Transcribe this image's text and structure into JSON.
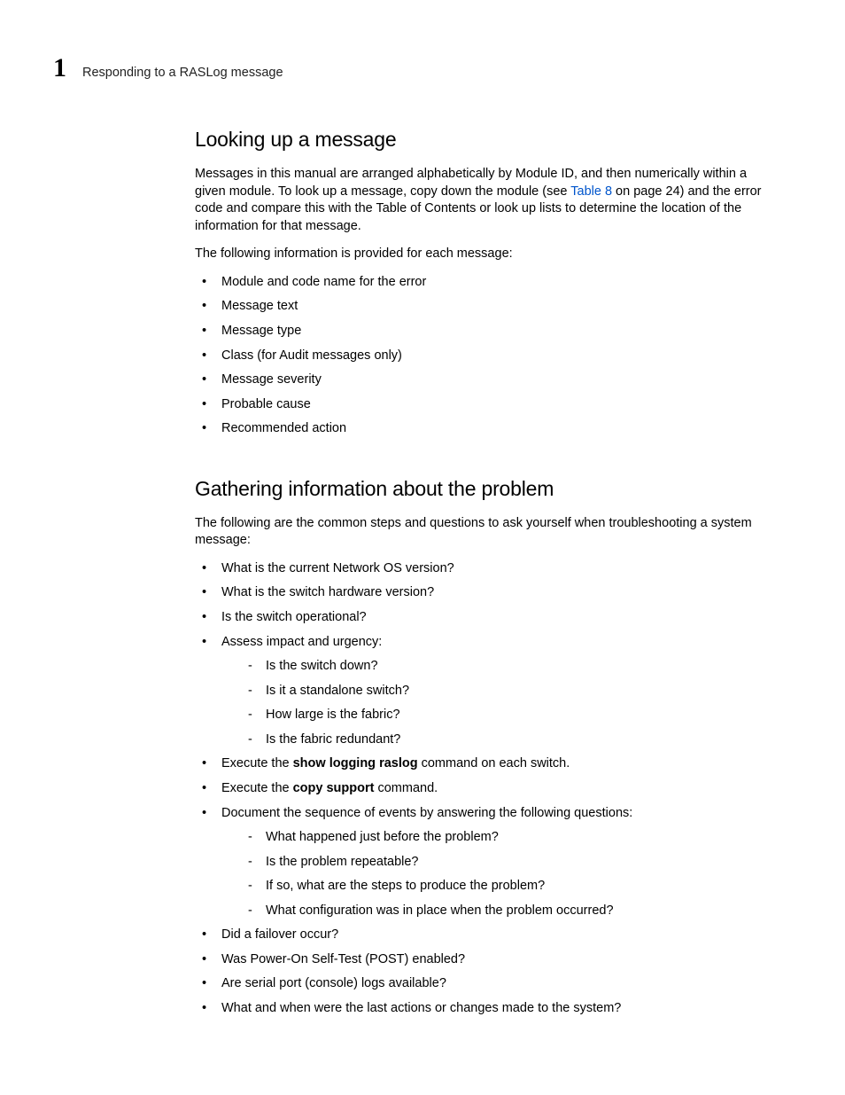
{
  "header": {
    "chapter_num": "1",
    "running_title": "Responding to a RASLog message"
  },
  "section1": {
    "heading": "Looking up a message",
    "para1_a": "Messages in this manual are arranged alphabetically by Module ID, and then numerically within a given module. To look up a message, copy down the module (see ",
    "para1_link": "Table 8",
    "para1_b": " on page 24) and the error code and compare this with the Table of Contents or look up lists to determine the location of the information for that message.",
    "para2": "The following information is provided for each message:",
    "bullets": [
      "Module and code name for the error",
      "Message text",
      "Message type",
      "Class (for Audit messages only)",
      "Message severity",
      "Probable cause",
      "Recommended action"
    ]
  },
  "section2": {
    "heading": "Gathering information about the problem",
    "para1": "The following are the common steps and questions to ask yourself when troubleshooting a system message:",
    "b1": "What is the current Network OS version?",
    "b2": "What is the switch hardware version?",
    "b3": "Is the switch operational?",
    "b4": "Assess impact and urgency:",
    "b4_sub": [
      "Is the switch down?",
      "Is it a standalone switch?",
      "How large is the fabric?",
      "Is the fabric redundant?"
    ],
    "b5_a": "Execute the ",
    "b5_bold": "show logging raslog",
    "b5_b": " command on each switch.",
    "b6_a": "Execute the ",
    "b6_bold": "copy support",
    "b6_b": " command.",
    "b7": "Document the sequence of events by answering the following questions:",
    "b7_sub": [
      "What happened just before the problem?",
      "Is the problem repeatable?",
      "If so, what are the steps to produce the problem?",
      "What configuration was in place when the problem occurred?"
    ],
    "b8": "Did a failover occur?",
    "b9": "Was Power-On Self-Test (POST) enabled?",
    "b10": "Are serial port (console) logs available?",
    "b11": "What and when were the last actions or changes made to the system?"
  }
}
